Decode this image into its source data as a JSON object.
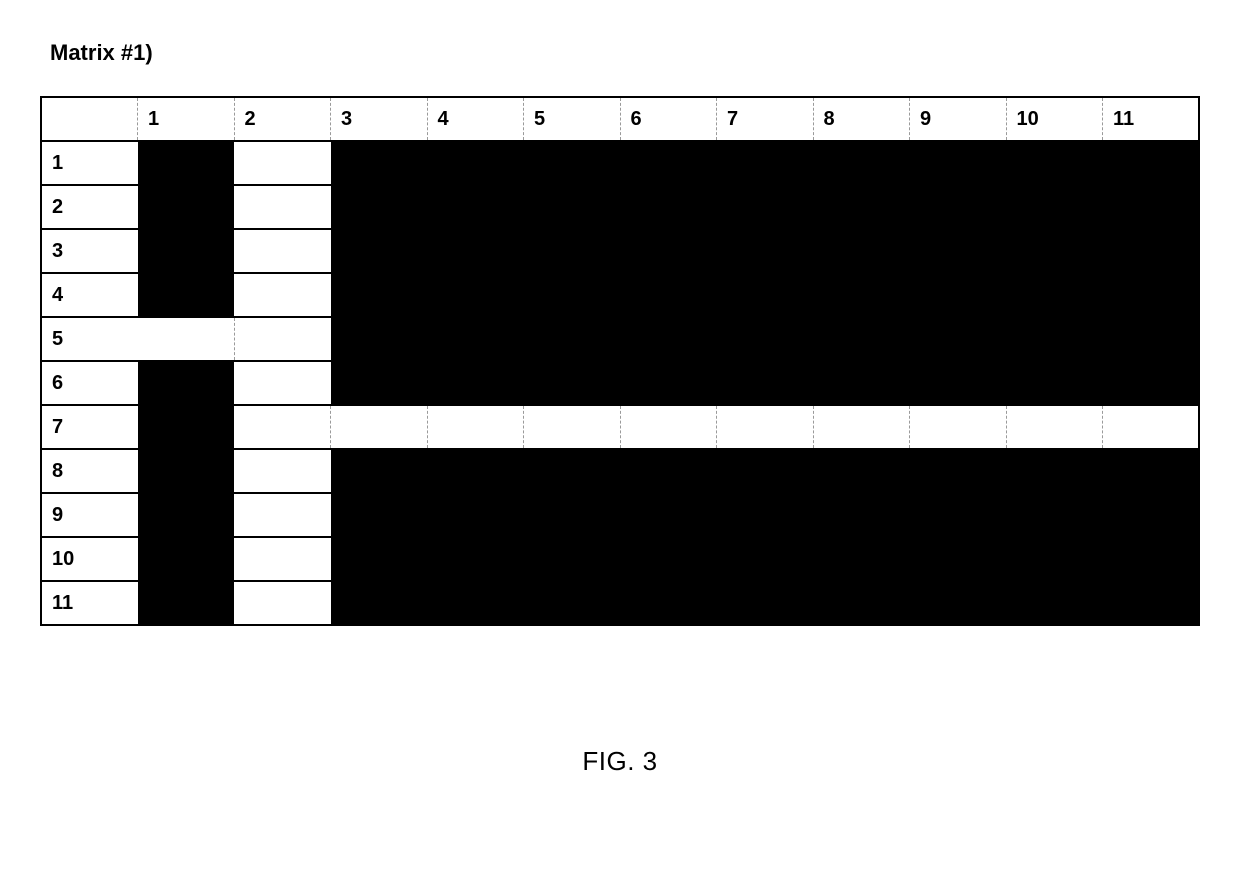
{
  "title": "Matrix #1)",
  "caption": "FIG. 3",
  "matrix": {
    "size": 11,
    "col_headers": [
      "1",
      "2",
      "3",
      "4",
      "5",
      "6",
      "7",
      "8",
      "9",
      "10",
      "11"
    ],
    "row_headers": [
      "1",
      "2",
      "3",
      "4",
      "5",
      "6",
      "7",
      "8",
      "9",
      "10",
      "11"
    ],
    "cells": [
      [
        1,
        0,
        1,
        1,
        1,
        1,
        1,
        1,
        1,
        1,
        1
      ],
      [
        1,
        0,
        1,
        1,
        1,
        1,
        1,
        1,
        1,
        1,
        1
      ],
      [
        1,
        0,
        1,
        1,
        1,
        1,
        1,
        1,
        1,
        1,
        1
      ],
      [
        1,
        0,
        1,
        1,
        1,
        1,
        1,
        1,
        1,
        1,
        1
      ],
      [
        0,
        0,
        1,
        1,
        1,
        1,
        1,
        1,
        1,
        1,
        1
      ],
      [
        1,
        0,
        1,
        1,
        1,
        1,
        1,
        1,
        1,
        1,
        1
      ],
      [
        1,
        0,
        0,
        0,
        0,
        0,
        0,
        0,
        0,
        0,
        0
      ],
      [
        1,
        0,
        1,
        1,
        1,
        1,
        1,
        1,
        1,
        1,
        1
      ],
      [
        1,
        0,
        1,
        1,
        1,
        1,
        1,
        1,
        1,
        1,
        1
      ],
      [
        1,
        0,
        1,
        1,
        1,
        1,
        1,
        1,
        1,
        1,
        1
      ],
      [
        1,
        0,
        1,
        1,
        1,
        1,
        1,
        1,
        1,
        1,
        1
      ]
    ]
  },
  "colors": {
    "filled": "#000000",
    "empty": "#ffffff"
  }
}
